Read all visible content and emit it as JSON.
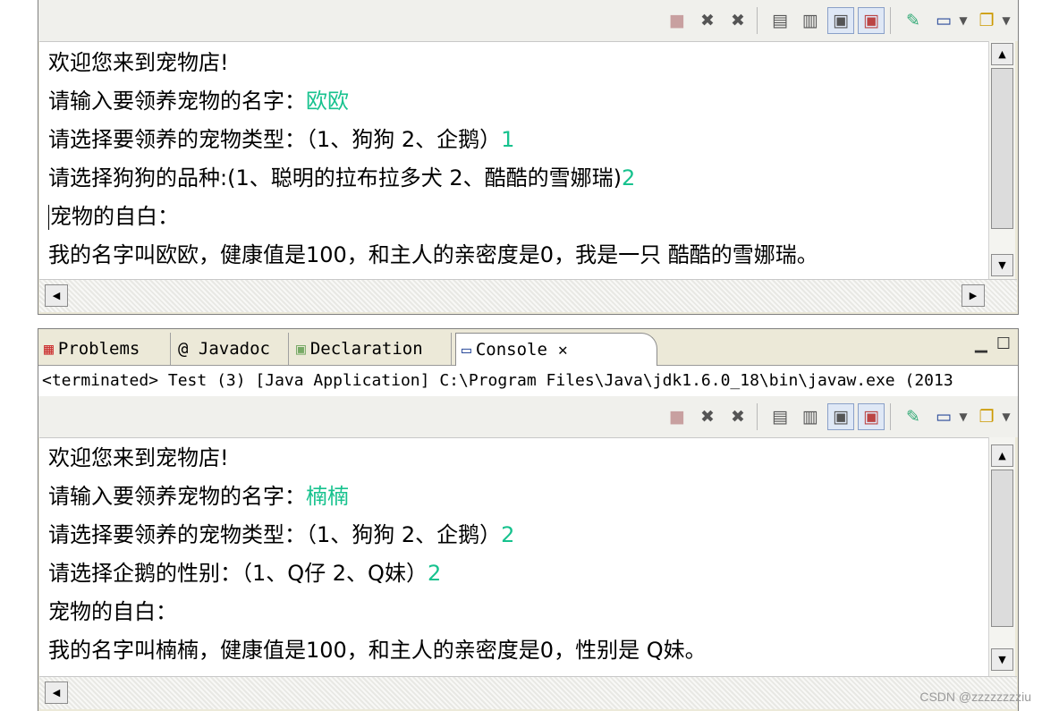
{
  "toolbar": {
    "icons": [
      "terminate-icon",
      "remove-launch-icon",
      "remove-all-icon",
      "scroll-lock-icon",
      "show-stdout-icon",
      "show-stderr-icon",
      "pin-console-icon",
      "display-console-icon",
      "open-console-icon"
    ]
  },
  "console1": {
    "lines": [
      {
        "text": "欢迎您来到宠物店!",
        "input": ""
      },
      {
        "text": "请输入要领养宠物的名字：",
        "input": "欧欧"
      },
      {
        "text": "请选择要领养的宠物类型：（1、狗狗 2、企鹅）",
        "input": "1"
      },
      {
        "text": "请选择狗狗的品种:(1、聪明的拉布拉多犬 2、酷酷的雪娜瑞)",
        "input": "2"
      },
      {
        "text": "宠物的自白：",
        "input": ""
      },
      {
        "text": "我的名字叫欧欧，健康值是100，和主人的亲密度是0，我是一只 酷酷的雪娜瑞。",
        "input": ""
      }
    ]
  },
  "tabs": [
    {
      "label": "Problems"
    },
    {
      "label": "@ Javadoc"
    },
    {
      "label": "Declaration"
    },
    {
      "label": "Console"
    }
  ],
  "status": {
    "text": "<terminated> Test (3) [Java Application] C:\\Program Files\\Java\\jdk1.6.0_18\\bin\\javaw.exe (2013"
  },
  "console2": {
    "lines": [
      {
        "text": "欢迎您来到宠物店!",
        "input": ""
      },
      {
        "text": "请输入要领养宠物的名字：",
        "input": "楠楠"
      },
      {
        "text": "请选择要领养的宠物类型：（1、狗狗 2、企鹅）",
        "input": "2"
      },
      {
        "text": "请选择企鹅的性别：（1、Q仔 2、Q妹）",
        "input": "2"
      },
      {
        "text": "宠物的自白：",
        "input": ""
      },
      {
        "text": "我的名字叫楠楠，健康值是100，和主人的亲密度是0，性别是 Q妹。",
        "input": ""
      }
    ]
  },
  "watermark": "CSDN @zzzzzzzziu"
}
